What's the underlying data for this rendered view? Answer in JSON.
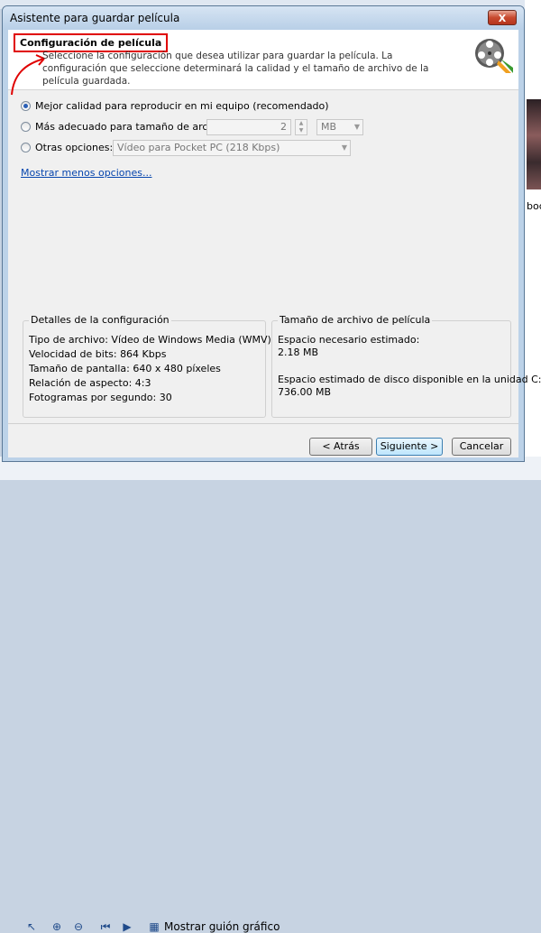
{
  "background": {
    "taskbar_label": "Mostrar guión gráfico",
    "side_text": "boc"
  },
  "window": {
    "title": "Asistente para guardar película",
    "close_label": "X"
  },
  "header": {
    "title": "Configuración de película",
    "description": "Seleccione la configuración que desea utilizar para guardar la película. La configuración que seleccione determinará la calidad y el tamaño de archivo de la película guardada."
  },
  "options": {
    "best_quality": "Mejor calidad para reproducir en mi equipo (recomendado)",
    "best_fit": "Más adecuado para tamaño de archivo:",
    "size_value": "2",
    "size_unit": "MB",
    "other": "Otras opciones:",
    "other_value": "Vídeo para Pocket PC (218 Kbps)",
    "selected": "best_quality",
    "show_less": "Mostrar menos opciones..."
  },
  "details": {
    "label": "Detalles de la configuración",
    "lines": [
      "Tipo de archivo: Vídeo de Windows Media (WMV)",
      "Velocidad de bits: 864 Kbps",
      "Tamaño de pantalla: 640 x 480 píxeles",
      "Relación de aspecto: 4:3",
      "Fotogramas por segundo: 30"
    ]
  },
  "filesize": {
    "label": "Tamaño de archivo de película",
    "needed_label": "Espacio necesario estimado:",
    "needed_value": "2.18 MB",
    "available_label": "Espacio estimado de disco disponible en la unidad C:",
    "available_value": "736.00 MB"
  },
  "buttons": {
    "back": "< Atrás",
    "next": "Siguiente >",
    "cancel": "Cancelar"
  },
  "colors": {
    "accent_red": "#e00000",
    "link": "#0645ad",
    "titlebar": "#b8cfe7"
  }
}
